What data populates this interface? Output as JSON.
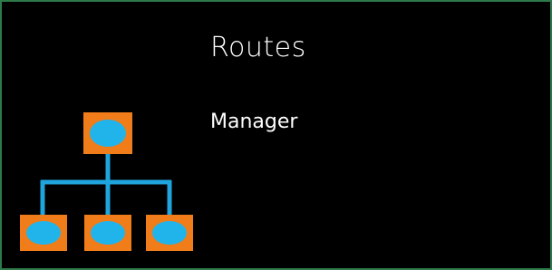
{
  "tile": {
    "title": "Routes",
    "subtitle": "Manager",
    "icon": "org-chart-icon"
  },
  "colors": {
    "background": "#000000",
    "border": "#2e7a4a",
    "node_fill": "#f07c1a",
    "node_inner": "#21b4ea",
    "connector": "#1fa5dc",
    "text": "#ffffff"
  }
}
